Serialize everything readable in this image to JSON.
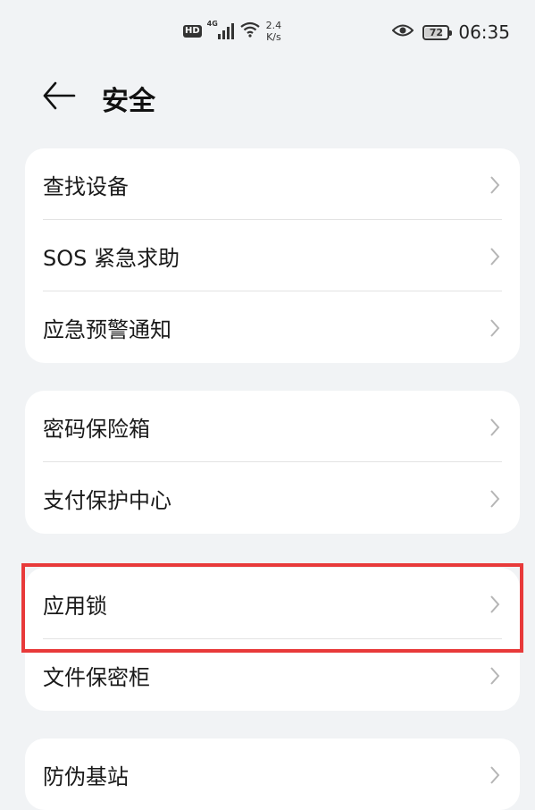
{
  "status_bar": {
    "hd": "HD",
    "network": "4G",
    "speed_value": "2.4",
    "speed_unit": "K/s",
    "battery": "72",
    "time": "06:35"
  },
  "header": {
    "title": "安全"
  },
  "groups": [
    {
      "items": [
        {
          "label": "查找设备"
        },
        {
          "label": "SOS 紧急求助"
        },
        {
          "label": "应急预警通知"
        }
      ]
    },
    {
      "items": [
        {
          "label": "密码保险箱"
        },
        {
          "label": "支付保护中心"
        }
      ]
    },
    {
      "items": [
        {
          "label": "应用锁"
        },
        {
          "label": "文件保密柜"
        }
      ]
    },
    {
      "items": [
        {
          "label": "防伪基站"
        }
      ]
    }
  ],
  "colors": {
    "highlight": "#e83a3a",
    "background": "#f1f3f5",
    "card": "#ffffff"
  },
  "icons": [
    "back-arrow-icon",
    "chevron-right-icon",
    "eye-icon",
    "wifi-icon",
    "signal-icon",
    "battery-icon"
  ]
}
